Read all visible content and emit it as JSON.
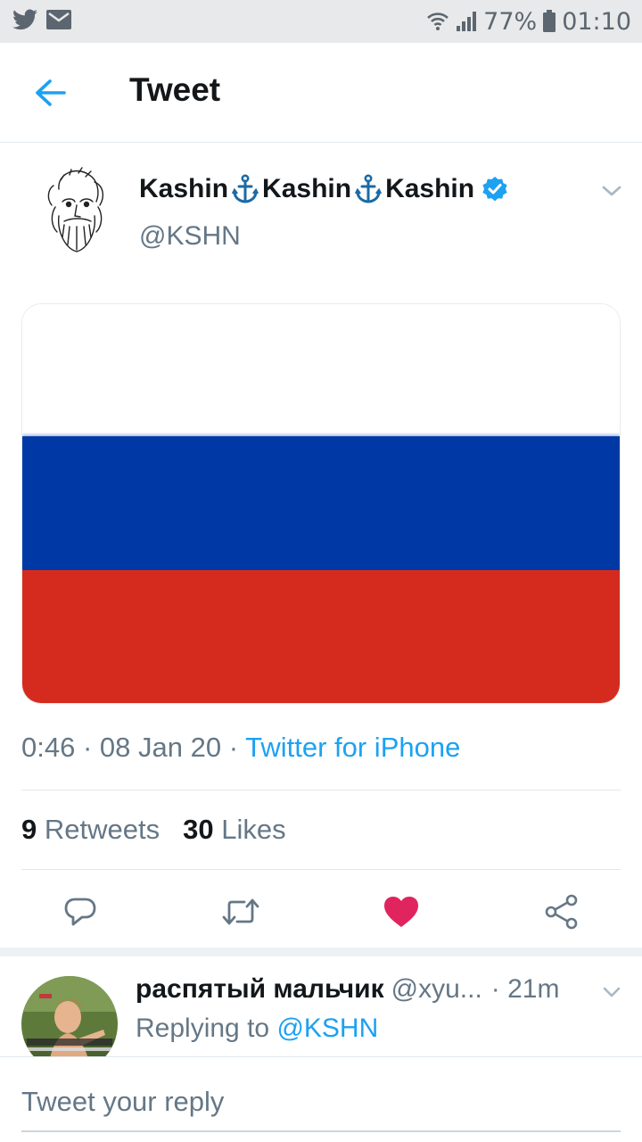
{
  "status_bar": {
    "battery": "77%",
    "time": "01:10",
    "left_icons": [
      "twitter-icon",
      "mail-icon"
    ],
    "right_icons": [
      "wifi-icon",
      "signal-icon",
      "battery-icon"
    ]
  },
  "header": {
    "title": "Tweet",
    "back_icon": "arrow-left-icon"
  },
  "tweet": {
    "author": {
      "name_parts": [
        "Kashin",
        "Kashin",
        "Kashin"
      ],
      "separator_icon": "anchor-icon",
      "verified": true,
      "handle": "@KSHN"
    },
    "media": {
      "description_icon": "russian-flag",
      "stripes": [
        "#ffffff",
        "#0039a6",
        "#d52b1e"
      ]
    },
    "time": "0:46",
    "date": "08 Jan 20",
    "dot": "·",
    "source": "Twitter for iPhone",
    "stats": {
      "retweets_count": "9",
      "retweets_label": "Retweets",
      "likes_count": "30",
      "likes_label": "Likes"
    },
    "actions": [
      "reply-icon",
      "retweet-icon",
      "like-icon",
      "share-icon"
    ],
    "liked": true
  },
  "reply": {
    "name": "распятый мальчик",
    "handle": "@xyu...",
    "time": "· 21m",
    "replying_prefix": "Replying to",
    "replying_to": "@KSHN"
  },
  "compose": {
    "placeholder": "Tweet your reply"
  },
  "colors": {
    "accent": "#1da1f2",
    "like": "#e0245e",
    "muted": "#657786",
    "text": "#14171a",
    "anchor": "#1b6aa5"
  }
}
